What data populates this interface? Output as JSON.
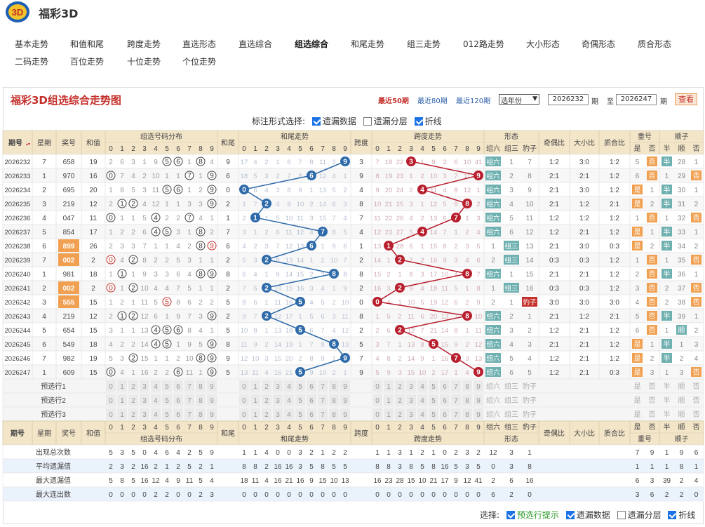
{
  "app": {
    "title": "福彩3D"
  },
  "nav": [
    "基本走势",
    "和值和尾",
    "跨度走势",
    "直选形态",
    "直选综合",
    "组选综合",
    "和尾走势",
    "组三走势",
    "012路走势",
    "大小形态",
    "奇偶形态",
    "质合形态",
    "二码走势",
    "百位走势",
    "十位走势",
    "个位走势"
  ],
  "nav_active": "组选综合",
  "panel": {
    "title": "福彩3D组选综合走势图",
    "ranges": [
      "最近50期",
      "最近80期",
      "最近120期"
    ],
    "range_active": "最近50期",
    "year_select": "选年份",
    "from_label": "期",
    "to_prefix": "至",
    "to_label": "期",
    "from_value": "2026232",
    "to_value": "2026247",
    "query_button": "查看"
  },
  "mark": {
    "label": "标注形式选择:",
    "options": [
      {
        "label": "遗漏数据",
        "checked": true
      },
      {
        "label": "遗漏分层",
        "checked": false
      },
      {
        "label": "折线",
        "checked": true
      }
    ]
  },
  "headers": {
    "issue": "期号",
    "weekday": "星期",
    "prize": "奖号",
    "sum": "和值",
    "group": "组选号码分布",
    "sumtail": "和尾",
    "tailtrend": "和尾走势",
    "span": "跨度",
    "spantrend": "跨度走势",
    "shape": "形态",
    "shape_cols": [
      "组六",
      "组三",
      "豹子"
    ],
    "oe": "奇偶比",
    "bs": "大小比",
    "pc": "质合比",
    "dup": "重号",
    "dup_cols": [
      "是",
      "否"
    ],
    "seq": "顺子",
    "seq_cols": [
      "半",
      "顺",
      "否"
    ],
    "digits": [
      "0",
      "1",
      "2",
      "3",
      "4",
      "5",
      "6",
      "7",
      "8",
      "9"
    ]
  },
  "rows": [
    {
      "issue": "2026232",
      "week": "7",
      "prize": "658",
      "sum": "19",
      "group": [
        "2",
        "6",
        "3",
        "1",
        "9",
        "⑤",
        "⑥",
        "1",
        "⑧",
        "4"
      ],
      "tail": "9",
      "tailrow": [
        "17",
        "4",
        "2",
        "1",
        "6",
        "7",
        "8",
        "11",
        "3",
        "●"
      ],
      "span": "3",
      "spanrow": [
        "7",
        "18",
        "22",
        "●",
        "1",
        "9",
        "2",
        "6",
        "10",
        "41"
      ],
      "shape": [
        "组六",
        "1",
        "7"
      ],
      "oe": "1:2",
      "bs": "3:0",
      "pc": "1:2",
      "dup": [
        "5",
        "否"
      ],
      "seq": [
        "半",
        "28",
        "1"
      ]
    },
    {
      "issue": "2026233",
      "week": "1",
      "prize": "970",
      "sum": "16",
      "group": [
        "⓪",
        "7",
        "4",
        "2",
        "10",
        "1",
        "1",
        "⑦",
        "1",
        "⑨"
      ],
      "tail": "6",
      "tailrow": [
        "18",
        "5",
        "3",
        "2",
        "7",
        "8",
        "●",
        "12",
        "4",
        "1"
      ],
      "span": "9",
      "spanrow": [
        "8",
        "19",
        "23",
        "1",
        "2",
        "10",
        "3",
        "7",
        "11",
        "●"
      ],
      "shape": [
        "组六",
        "2",
        "8"
      ],
      "oe": "2:1",
      "bs": "2:1",
      "pc": "1:2",
      "dup": [
        "6",
        "否"
      ],
      "seq": [
        "1",
        "29",
        "否"
      ]
    },
    {
      "issue": "2026234",
      "week": "2",
      "prize": "695",
      "sum": "20",
      "group": [
        "1",
        "8",
        "5",
        "3",
        "11",
        "⑤",
        "⑥",
        "1",
        "2",
        "⑨"
      ],
      "tail": "0",
      "tailrow": [
        "●",
        "6",
        "4",
        "3",
        "8",
        "9",
        "1",
        "13",
        "5",
        "2"
      ],
      "span": "4",
      "spanrow": [
        "9",
        "20",
        "24",
        "2",
        "●",
        "11",
        "4",
        "8",
        "12",
        "1"
      ],
      "shape": [
        "组六",
        "3",
        "9"
      ],
      "oe": "2:1",
      "bs": "3:0",
      "pc": "1:2",
      "dup": [
        "是",
        "1"
      ],
      "seq": [
        "半",
        "30",
        "1"
      ]
    },
    {
      "issue": "2026235",
      "week": "3",
      "prize": "219",
      "sum": "12",
      "group": [
        "2",
        "①",
        "②",
        "4",
        "12",
        "1",
        "1",
        "3",
        "3",
        "⑨"
      ],
      "tail": "2",
      "tailrow": [
        "1",
        "7",
        "●",
        "4",
        "9",
        "10",
        "2",
        "14",
        "6",
        "3"
      ],
      "span": "8",
      "spanrow": [
        "10",
        "21",
        "25",
        "3",
        "1",
        "12",
        "5",
        "9",
        "●",
        "2"
      ],
      "shape": [
        "组六",
        "4",
        "10"
      ],
      "oe": "2:1",
      "bs": "1:2",
      "pc": "2:1",
      "dup": [
        "是",
        "2"
      ],
      "seq": [
        "半",
        "31",
        "2"
      ]
    },
    {
      "issue": "2026236",
      "week": "4",
      "prize": "047",
      "sum": "11",
      "group": [
        "⓪",
        "1",
        "1",
        "5",
        "④",
        "2",
        "2",
        "⑦",
        "4",
        "1"
      ],
      "tail": "1",
      "tailrow": [
        "2",
        "●",
        "1",
        "5",
        "10",
        "11",
        "3",
        "15",
        "7",
        "4"
      ],
      "span": "7",
      "spanrow": [
        "11",
        "22",
        "26",
        "4",
        "2",
        "13",
        "6",
        "●",
        "1",
        "3"
      ],
      "shape": [
        "组六",
        "5",
        "11"
      ],
      "oe": "1:2",
      "bs": "1:2",
      "pc": "1:2",
      "dup": [
        "1",
        "否"
      ],
      "seq": [
        "1",
        "32",
        "否"
      ]
    },
    {
      "issue": "2026237",
      "week": "5",
      "prize": "854",
      "sum": "17",
      "group": [
        "1",
        "2",
        "2",
        "6",
        "④",
        "⑤",
        "3",
        "1",
        "⑧",
        "2"
      ],
      "tail": "7",
      "tailrow": [
        "3",
        "1",
        "2",
        "6",
        "11",
        "12",
        "4",
        "●",
        "8",
        "5"
      ],
      "span": "4",
      "spanrow": [
        "12",
        "23",
        "27",
        "5",
        "●",
        "14",
        "7",
        "1",
        "2",
        "4"
      ],
      "shape": [
        "组六",
        "6",
        "12"
      ],
      "oe": "1:2",
      "bs": "2:1",
      "pc": "1:2",
      "dup": [
        "是",
        "1"
      ],
      "seq": [
        "半",
        "33",
        "1"
      ]
    },
    {
      "issue": "2026238",
      "week": "6",
      "prize": "899",
      "sum": "26",
      "group": [
        "2",
        "3",
        "3",
        "7",
        "1",
        "1",
        "4",
        "2",
        "⑧",
        "⑨"
      ],
      "tail": "6",
      "tailrow": [
        "4",
        "2",
        "3",
        "7",
        "12",
        "13",
        "●",
        "1",
        "9",
        "6"
      ],
      "span": "1",
      "spanrow": [
        "13",
        "●",
        "28",
        "6",
        "1",
        "15",
        "8",
        "2",
        "3",
        "5"
      ],
      "shape": [
        "1",
        "组三",
        "13"
      ],
      "oe": "2:1",
      "bs": "3:0",
      "pc": "0:3",
      "dup": [
        "是",
        "2"
      ],
      "seq": [
        "半",
        "34",
        "2"
      ]
    },
    {
      "issue": "2026239",
      "week": "7",
      "prize": "002",
      "sum": "2",
      "group": [
        "⓪",
        "4",
        "②",
        "8",
        "2",
        "2",
        "5",
        "3",
        "1",
        "1"
      ],
      "tail": "2",
      "tailrow": [
        "5",
        "3",
        "●",
        "8",
        "13",
        "14",
        "1",
        "2",
        "10",
        "7"
      ],
      "span": "2",
      "spanrow": [
        "14",
        "1",
        "●",
        "7",
        "2",
        "16",
        "9",
        "3",
        "4",
        "6"
      ],
      "shape": [
        "2",
        "组三",
        "14"
      ],
      "oe": "0:3",
      "bs": "0:3",
      "pc": "1:2",
      "dup": [
        "1",
        "否"
      ],
      "seq": [
        "1",
        "35",
        "否"
      ]
    },
    {
      "issue": "2026240",
      "week": "1",
      "prize": "981",
      "sum": "18",
      "group": [
        "1",
        "①",
        "1",
        "9",
        "3",
        "3",
        "6",
        "4",
        "⑧",
        "⑨"
      ],
      "tail": "8",
      "tailrow": [
        "6",
        "4",
        "1",
        "9",
        "14",
        "15",
        "2",
        "3",
        "●",
        "8"
      ],
      "span": "8",
      "spanrow": [
        "15",
        "2",
        "1",
        "8",
        "3",
        "17",
        "10",
        "4",
        "●",
        "7"
      ],
      "shape": [
        "组六",
        "1",
        "15"
      ],
      "oe": "2:1",
      "bs": "2:1",
      "pc": "1:2",
      "dup": [
        "2",
        "否"
      ],
      "seq": [
        "半",
        "36",
        "1"
      ]
    },
    {
      "issue": "2026241",
      "week": "2",
      "prize": "002",
      "sum": "2",
      "group": [
        "⓪",
        "1",
        "②",
        "10",
        "4",
        "4",
        "7",
        "5",
        "1",
        "1"
      ],
      "tail": "2",
      "tailrow": [
        "7",
        "5",
        "●",
        "10",
        "15",
        "16",
        "3",
        "4",
        "1",
        "9"
      ],
      "span": "2",
      "spanrow": [
        "16",
        "3",
        "●",
        "9",
        "4",
        "18",
        "11",
        "5",
        "1",
        "8"
      ],
      "shape": [
        "1",
        "组三",
        "16"
      ],
      "oe": "0:3",
      "bs": "0:3",
      "pc": "1:2",
      "dup": [
        "3",
        "否"
      ],
      "seq": [
        "2",
        "37",
        "否"
      ]
    },
    {
      "issue": "2026242",
      "week": "3",
      "prize": "555",
      "sum": "15",
      "group": [
        "1",
        "2",
        "1",
        "11",
        "5",
        "⑤",
        "8",
        "6",
        "2",
        "2"
      ],
      "tail": "5",
      "tailrow": [
        "8",
        "6",
        "1",
        "11",
        "16",
        "●",
        "4",
        "5",
        "2",
        "10"
      ],
      "span": "0",
      "spanrow": [
        "●",
        "4",
        "1",
        "10",
        "5",
        "19",
        "12",
        "6",
        "2",
        "9"
      ],
      "shape": [
        "2",
        "1",
        "豹子"
      ],
      "oe": "3:0",
      "bs": "3:0",
      "pc": "3:0",
      "dup": [
        "4",
        "否"
      ],
      "seq": [
        "2",
        "38",
        "否"
      ]
    },
    {
      "issue": "2026243",
      "week": "4",
      "prize": "219",
      "sum": "12",
      "group": [
        "2",
        "①",
        "②",
        "12",
        "6",
        "1",
        "9",
        "7",
        "3",
        "⑨"
      ],
      "tail": "2",
      "tailrow": [
        "9",
        "7",
        "●",
        "12",
        "17",
        "1",
        "5",
        "6",
        "3",
        "11"
      ],
      "span": "8",
      "spanrow": [
        "1",
        "5",
        "2",
        "11",
        "6",
        "20",
        "13",
        "7",
        "●",
        "10"
      ],
      "shape": [
        "组六",
        "2",
        "1"
      ],
      "oe": "2:1",
      "bs": "1:2",
      "pc": "2:1",
      "dup": [
        "5",
        "否"
      ],
      "seq": [
        "半",
        "39",
        "1"
      ]
    },
    {
      "issue": "2026244",
      "week": "5",
      "prize": "654",
      "sum": "15",
      "group": [
        "3",
        "1",
        "1",
        "13",
        "④",
        "⑤",
        "⑥",
        "8",
        "4",
        "1"
      ],
      "tail": "5",
      "tailrow": [
        "10",
        "8",
        "1",
        "13",
        "18",
        "●",
        "6",
        "7",
        "4",
        "12"
      ],
      "span": "2",
      "spanrow": [
        "2",
        "6",
        "●",
        "12",
        "7",
        "21",
        "14",
        "8",
        "1",
        "11"
      ],
      "shape": [
        "组六",
        "3",
        "2"
      ],
      "oe": "1:2",
      "bs": "2:1",
      "pc": "1:2",
      "dup": [
        "6",
        "否"
      ],
      "seq": [
        "1",
        "顺",
        "2"
      ]
    },
    {
      "issue": "2026245",
      "week": "6",
      "prize": "549",
      "sum": "18",
      "group": [
        "4",
        "2",
        "2",
        "14",
        "④",
        "⑤",
        "1",
        "9",
        "5",
        "⑨"
      ],
      "tail": "8",
      "tailrow": [
        "11",
        "9",
        "2",
        "14",
        "19",
        "1",
        "7",
        "8",
        "●",
        "13"
      ],
      "span": "5",
      "spanrow": [
        "3",
        "7",
        "1",
        "13",
        "8",
        "●",
        "15",
        "9",
        "2",
        "12"
      ],
      "shape": [
        "组六",
        "4",
        "3"
      ],
      "oe": "2:1",
      "bs": "2:1",
      "pc": "1:2",
      "dup": [
        "是",
        "1"
      ],
      "seq": [
        "半",
        "1",
        "3"
      ]
    },
    {
      "issue": "2026246",
      "week": "7",
      "prize": "982",
      "sum": "19",
      "group": [
        "5",
        "3",
        "②",
        "15",
        "1",
        "1",
        "2",
        "10",
        "⑧",
        "⑨"
      ],
      "tail": "9",
      "tailrow": [
        "12",
        "10",
        "3",
        "15",
        "20",
        "2",
        "8",
        "9",
        "1",
        "●"
      ],
      "span": "7",
      "spanrow": [
        "4",
        "8",
        "2",
        "14",
        "9",
        "1",
        "16",
        "●",
        "3",
        "13"
      ],
      "shape": [
        "组六",
        "5",
        "4"
      ],
      "oe": "1:2",
      "bs": "2:1",
      "pc": "1:2",
      "dup": [
        "是",
        "2"
      ],
      "seq": [
        "半",
        "2",
        "4"
      ]
    },
    {
      "issue": "2026247",
      "week": "1",
      "prize": "609",
      "sum": "15",
      "group": [
        "⓪",
        "4",
        "1",
        "16",
        "2",
        "2",
        "⑥",
        "11",
        "1",
        "⑨"
      ],
      "tail": "5",
      "tailrow": [
        "13",
        "11",
        "4",
        "16",
        "21",
        "●",
        "9",
        "10",
        "2",
        "1"
      ],
      "span": "9",
      "spanrow": [
        "5",
        "9",
        "3",
        "15",
        "10",
        "2",
        "17",
        "1",
        "4",
        "●"
      ],
      "shape": [
        "组六",
        "6",
        "5"
      ],
      "oe": "1:2",
      "bs": "2:1",
      "pc": "0:3",
      "dup": [
        "是",
        "3"
      ],
      "seq": [
        "1",
        "3",
        "否"
      ]
    }
  ],
  "pre_rows": [
    "预选行1",
    "预选行2",
    "预选行3"
  ],
  "stats": [
    {
      "label": "出现总次数",
      "group": [
        "5",
        "3",
        "5",
        "0",
        "4",
        "6",
        "4",
        "2",
        "5",
        "9"
      ],
      "tail": [
        "1",
        "1",
        "4",
        "0",
        "0",
        "3",
        "2",
        "1",
        "2",
        "2"
      ],
      "span": [
        "1",
        "1",
        "3",
        "1",
        "2",
        "1",
        "0",
        "2",
        "3",
        "2"
      ],
      "shape": [
        "12",
        "3",
        "1"
      ],
      "dup": [
        "7",
        "9"
      ],
      "seq": [
        "1",
        "6"
      ],
      "seqx": "9"
    },
    {
      "label": "平均遗漏值",
      "group": [
        "2",
        "3",
        "2",
        "16",
        "2",
        "1",
        "2",
        "5",
        "2",
        "1"
      ],
      "tail": [
        "8",
        "8",
        "2",
        "16",
        "16",
        "3",
        "5",
        "8",
        "5",
        "5"
      ],
      "span": [
        "8",
        "8",
        "3",
        "8",
        "5",
        "8",
        "16",
        "5",
        "3",
        "5"
      ],
      "shape": [
        "0",
        "3",
        "8"
      ],
      "dup": [
        "1",
        "1"
      ],
      "seq": [
        "1",
        "1"
      ],
      "seqx": "8"
    },
    {
      "label": "最大遗漏值",
      "group": [
        "5",
        "8",
        "5",
        "16",
        "12",
        "4",
        "9",
        "11",
        "5",
        "4"
      ],
      "tail": [
        "18",
        "11",
        "4",
        "16",
        "21",
        "16",
        "9",
        "15",
        "10",
        "13"
      ],
      "span": [
        "16",
        "23",
        "28",
        "15",
        "10",
        "21",
        "17",
        "9",
        "12",
        "41"
      ],
      "shape": [
        "2",
        "6",
        "16"
      ],
      "dup": [
        "6",
        "3"
      ],
      "seq": [
        "39",
        "4"
      ],
      "seqx": "2"
    },
    {
      "label": "最大连出数",
      "group": [
        "0",
        "0",
        "0",
        "0",
        "2",
        "2",
        "0",
        "0",
        "2",
        "3"
      ],
      "tail": [
        "0",
        "0",
        "0",
        "0",
        "0",
        "0",
        "0",
        "0",
        "0",
        "0"
      ],
      "span": [
        "0",
        "0",
        "0",
        "0",
        "0",
        "0",
        "0",
        "0",
        "0",
        "0"
      ],
      "shape": [
        "6",
        "2",
        "0"
      ],
      "dup": [
        "3",
        "6"
      ],
      "seq": [
        "2",
        "0"
      ],
      "seqx": "2"
    }
  ],
  "bottom": {
    "label": "选择:",
    "options": [
      {
        "label": "预选行提示",
        "checked": true,
        "green": true
      },
      {
        "label": "遗漏数据",
        "checked": true
      },
      {
        "label": "遗漏分层",
        "checked": false
      },
      {
        "label": "折线",
        "checked": true
      }
    ]
  },
  "colors": {
    "accent": "#c4302b",
    "header_bg": "#f3e5c8",
    "blue_ball": "#2e6aa9",
    "red_ball": "#b81e2d",
    "shape_badge": "#6fb0b0",
    "dup_badge": "#f0a050"
  }
}
